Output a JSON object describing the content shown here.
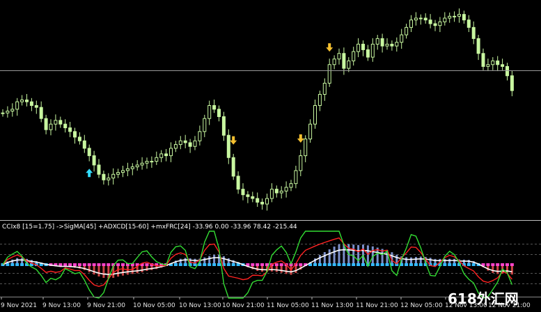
{
  "indicator": {
    "label": "CCIx8 [15=1.75] ->SigMA[45] +ADXCD[15-60] +mxFRC[24] -33.96 0.00 -33.96 78.42 -215.44"
  },
  "watermark": "618外汇网",
  "colors": {
    "background": "#000000",
    "candle": "#c8f7a0",
    "hline": "#9a9a9a",
    "arrow_up": "#33ddff",
    "arrow_down": "#f5c030",
    "cci": "#33dd33",
    "signal": "#ffffff",
    "adx": "#ff2222",
    "hist_pos": "#7b8fc9",
    "hist_neg": "#cc4444",
    "zero_band_a": "#33bbff",
    "zero_band_b": "#ff44cc"
  },
  "chart_data": {
    "type": "candlestick",
    "time_labels": [
      "9 Nov 2021",
      "9 Nov 13:00",
      "9 Nov 21:00",
      "10 Nov 05:00",
      "10 Nov 13:00",
      "10 Nov 21:00",
      "11 Nov 05:00",
      "11 Nov 13:00",
      "11 Nov 21:00",
      "12 Nov 05:00",
      "12 Nov 13:00",
      "12 Nov 21:00"
    ],
    "close": [
      0.46,
      0.47,
      0.48,
      0.52,
      0.53,
      0.52,
      0.5,
      0.49,
      0.43,
      0.37,
      0.4,
      0.42,
      0.4,
      0.38,
      0.36,
      0.33,
      0.31,
      0.27,
      0.23,
      0.18,
      0.13,
      0.1,
      0.11,
      0.13,
      0.14,
      0.15,
      0.16,
      0.17,
      0.18,
      0.19,
      0.2,
      0.2,
      0.22,
      0.24,
      0.23,
      0.27,
      0.29,
      0.31,
      0.3,
      0.28,
      0.31,
      0.36,
      0.43,
      0.5,
      0.48,
      0.44,
      0.34,
      0.22,
      0.12,
      0.05,
      0.02,
      0.01,
      0.0,
      -0.02,
      -0.03,
      0.0,
      0.05,
      0.03,
      0.04,
      0.06,
      0.08,
      0.15,
      0.23,
      0.32,
      0.4,
      0.5,
      0.56,
      0.62,
      0.72,
      0.75,
      0.78,
      0.7,
      0.74,
      0.79,
      0.83,
      0.8,
      0.76,
      0.83,
      0.86,
      0.82,
      0.83,
      0.82,
      0.84,
      0.88,
      0.92,
      0.96,
      0.97,
      0.97,
      0.96,
      0.94,
      0.93,
      0.95,
      0.97,
      0.98,
      0.98,
      0.99,
      0.96,
      0.92,
      0.86,
      0.78,
      0.71,
      0.72,
      0.74,
      0.72,
      0.71,
      0.66,
      0.58
    ]
  }
}
